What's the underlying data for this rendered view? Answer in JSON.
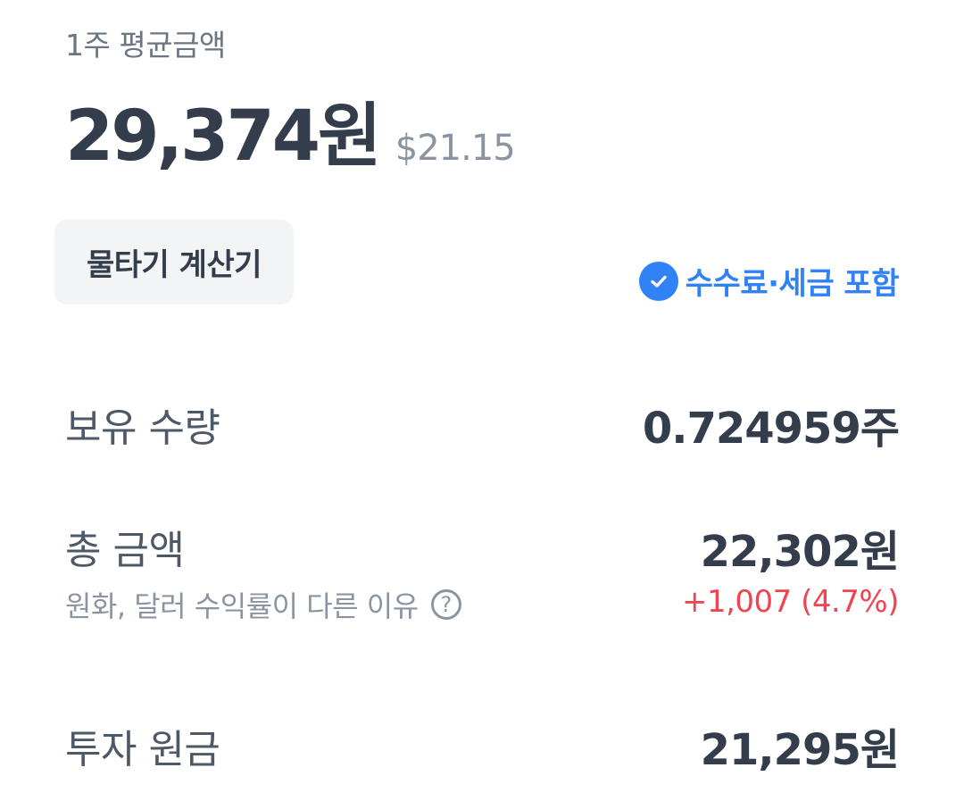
{
  "header": {
    "avg_label": "1주 평균금액",
    "price_krw": "29,374원",
    "price_usd": "$21.15"
  },
  "actions": {
    "calculator_label": "물타기 계산기",
    "fee_include_label": "수수료·세금 포함"
  },
  "details": {
    "quantity_label": "보유 수량",
    "quantity_value": "0.724959주",
    "total_label": "총 금액",
    "total_value": "22,302원",
    "reason_label": "원화, 달러 수익률이 다른 이유",
    "profit_value": "+1,007 (4.7%)",
    "principal_label": "투자 원금",
    "principal_value": "21,295원"
  },
  "icons": {
    "check": "check-circle-icon",
    "help": "question-circle-icon"
  },
  "colors": {
    "primary_text": "#333d4b",
    "secondary_text": "#8b95a1",
    "accent_blue": "#3182f6",
    "profit_red": "#f04452",
    "button_bg": "#f2f4f6"
  }
}
